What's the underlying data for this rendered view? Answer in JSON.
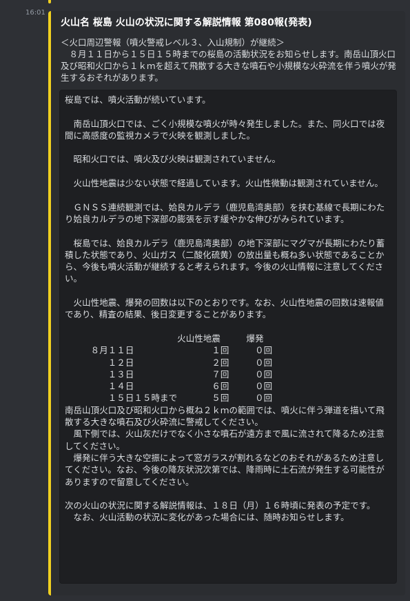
{
  "message": {
    "timestamp": "16:01",
    "embed": {
      "accent_color": "#f0d020",
      "title": "火山名 桜島 火山の状況に関する解説情報 第080報(発表)",
      "description": "＜火口周辺警報（噴火警戒レベル３、入山規制）が継続＞\n　８月１１日から１５日１５時までの桜島の活動状況をお知らせします。南岳山頂火口及び昭和火口から１ｋｍを超えて飛散する大きな噴石や小規模な火砕流を伴う噴火が発生するおそれがあります。",
      "code_block": "桜島では、噴火活動が続いています。\n\n　南岳山頂火口では、ごく小規模な噴火が時々発生しました。また、同火口では夜間に高感度の監視カメラで火映を観測しました。\n\n　昭和火口では、噴火及び火映は観測されていません。\n\n　火山性地震は少ない状態で経過しています。火山性微動は観測されていません。\n\n　ＧＮＳＳ連続観測では、姶良カルデラ（鹿児島湾奥部）を挟む基線で長期にわたり姶良カルデラの地下深部の膨張を示す緩やかな伸びがみられています。\n\n　桜島では、姶良カルデラ（鹿児島湾奥部）の地下深部にマグマが長期にわたり蓄積した状態であり、火山ガス（二酸化硫黄）の放出量も概ね多い状態であることから、今後も噴火活動が継続すると考えられます。今後の火山情報に注意してください。\n\n　火山性地震、爆発の回数は以下のとおりです。なお、火山性地震の回数は速報値であり、精査の結果、後日変更することがあります。\n\n　　　　　　　　　　　　　火山性地震　　　爆発\n　　　８月１１日　　　　　　　　　１回　　　０回\n　　　　　１２日　　　　　　　　　２回　　　０回\n　　　　　１３日　　　　　　　　　７回　　　０回\n　　　　　１４日　　　　　　　　　６回　　　０回\n　　　　　１５日１５時まで　　　　５回　　　０回\n南岳山頂火口及び昭和火口から概ね２ｋｍの範囲では、噴火に伴う弾道を描いて飛散する大きな噴石及び火砕流に警戒してください。\n　風下側では、火山灰だけでなく小さな噴石が遠方まで風に流されて降るため注意してください。\n　爆発に伴う大きな空振によって窓ガラスが割れるなどのおそれがあるため注意してください。なお、今後の降灰状況次第では、降雨時に土石流が発生する可能性がありますので留意してください。\n\n次の火山の状況に関する解説情報は、１８日（月）１６時頃に発表の予定です。\n　なお、火山活動の状況に変化があった場合には、随時お知らせします。"
    }
  }
}
